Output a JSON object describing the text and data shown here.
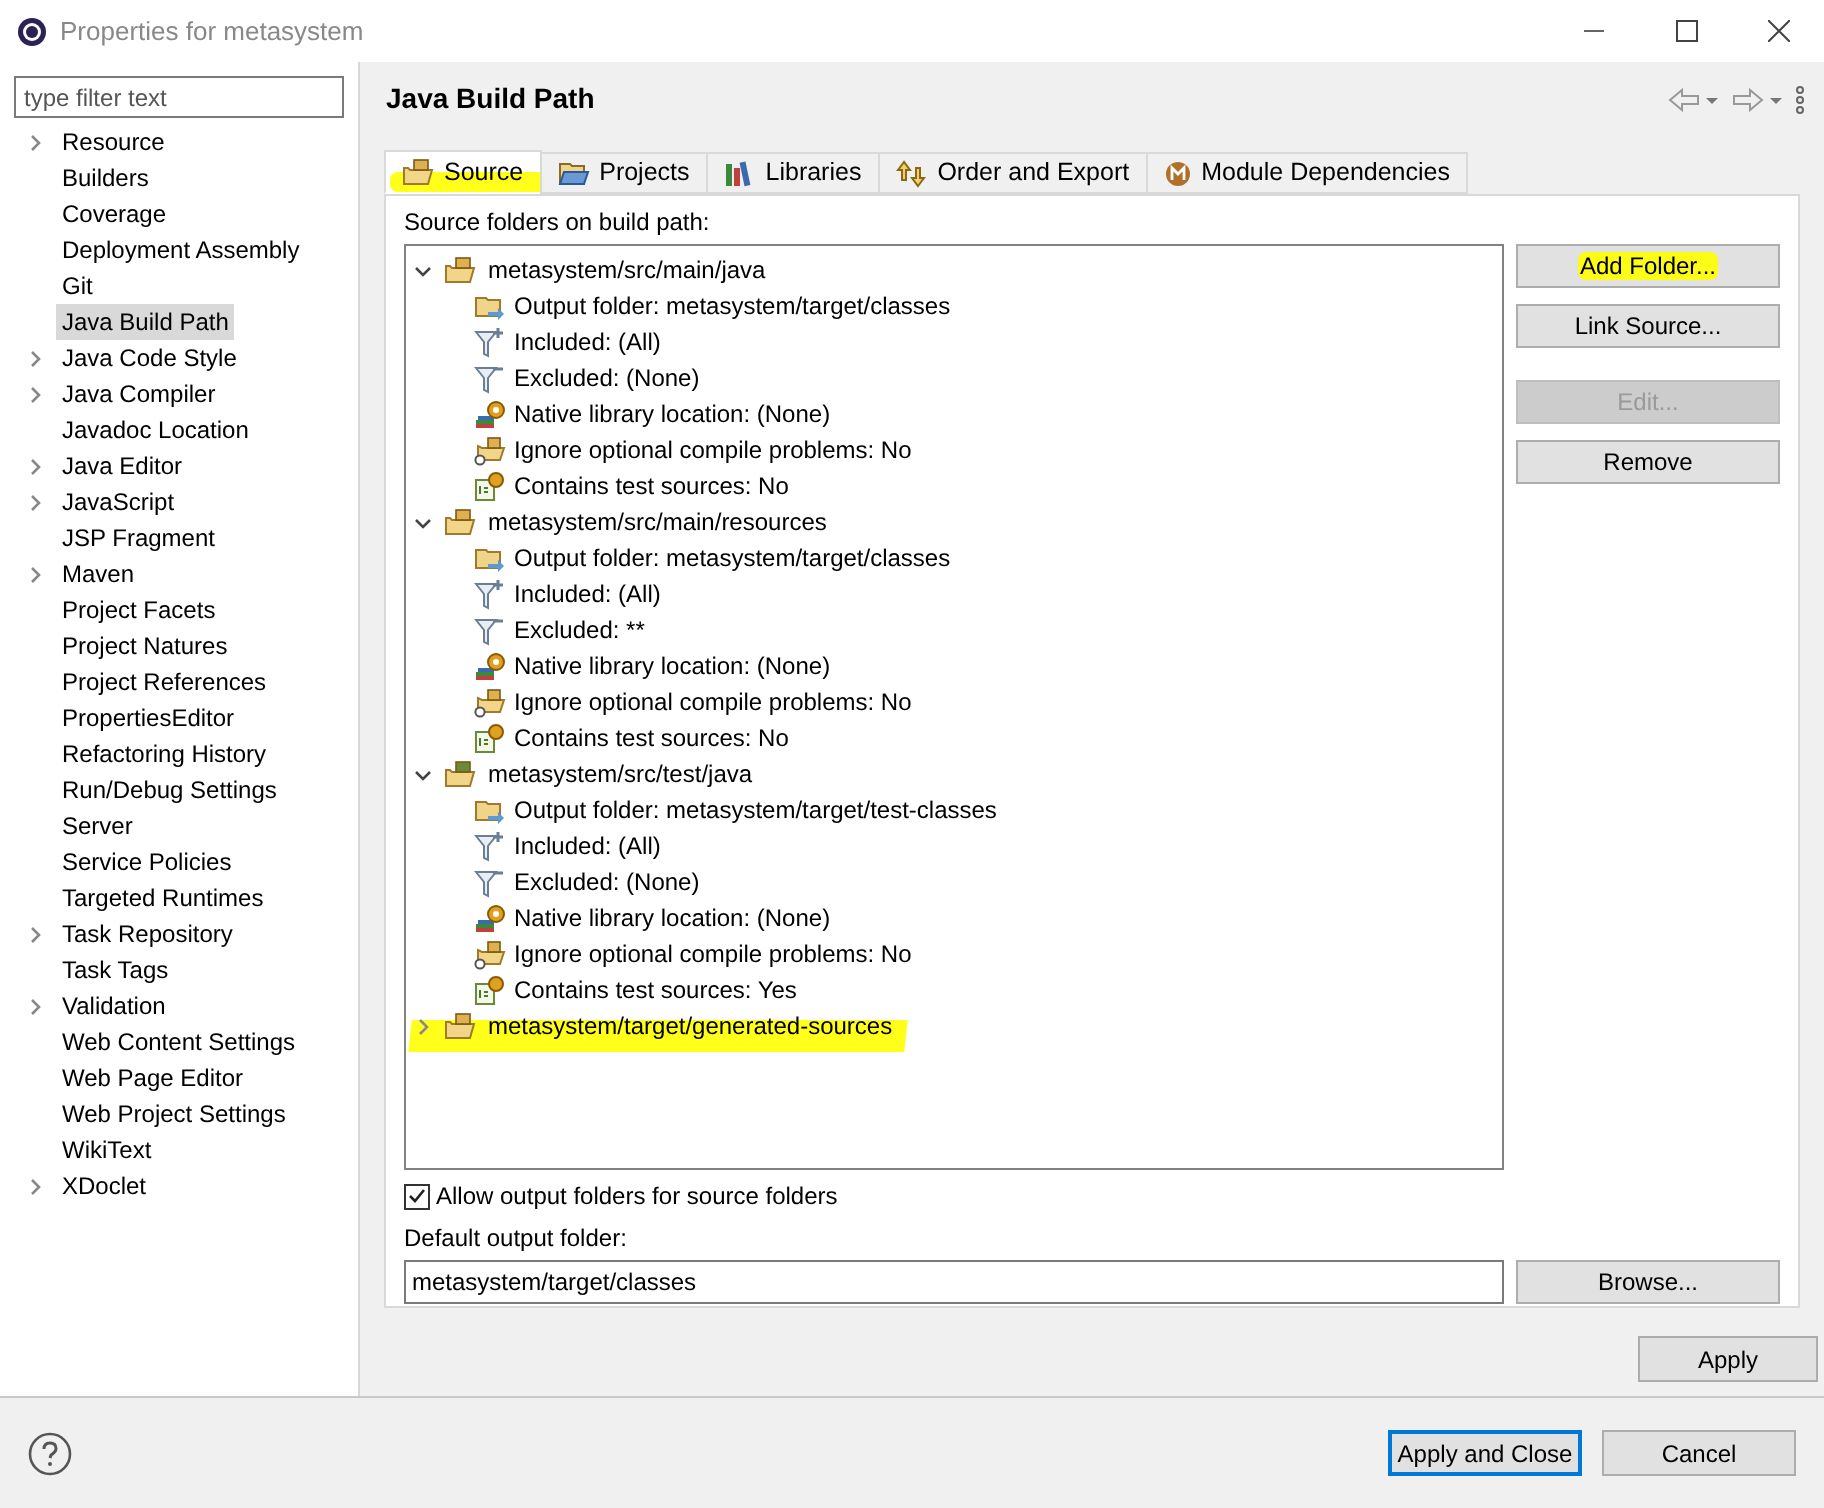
{
  "window": {
    "title": "Properties for metasystem"
  },
  "filter": {
    "placeholder": "type filter text"
  },
  "sidebar": {
    "items": [
      {
        "label": "Resource",
        "expandable": true,
        "selected": false
      },
      {
        "label": "Builders",
        "expandable": false,
        "selected": false
      },
      {
        "label": "Coverage",
        "expandable": false,
        "selected": false
      },
      {
        "label": "Deployment Assembly",
        "expandable": false,
        "selected": false
      },
      {
        "label": "Git",
        "expandable": false,
        "selected": false
      },
      {
        "label": "Java Build Path",
        "expandable": false,
        "selected": true
      },
      {
        "label": "Java Code Style",
        "expandable": true,
        "selected": false
      },
      {
        "label": "Java Compiler",
        "expandable": true,
        "selected": false
      },
      {
        "label": "Javadoc Location",
        "expandable": false,
        "selected": false
      },
      {
        "label": "Java Editor",
        "expandable": true,
        "selected": false
      },
      {
        "label": "JavaScript",
        "expandable": true,
        "selected": false
      },
      {
        "label": "JSP Fragment",
        "expandable": false,
        "selected": false
      },
      {
        "label": "Maven",
        "expandable": true,
        "selected": false
      },
      {
        "label": "Project Facets",
        "expandable": false,
        "selected": false
      },
      {
        "label": "Project Natures",
        "expandable": false,
        "selected": false
      },
      {
        "label": "Project References",
        "expandable": false,
        "selected": false
      },
      {
        "label": "PropertiesEditor",
        "expandable": false,
        "selected": false
      },
      {
        "label": "Refactoring History",
        "expandable": false,
        "selected": false
      },
      {
        "label": "Run/Debug Settings",
        "expandable": false,
        "selected": false
      },
      {
        "label": "Server",
        "expandable": false,
        "selected": false
      },
      {
        "label": "Service Policies",
        "expandable": false,
        "selected": false
      },
      {
        "label": "Targeted Runtimes",
        "expandable": false,
        "selected": false
      },
      {
        "label": "Task Repository",
        "expandable": true,
        "selected": false
      },
      {
        "label": "Task Tags",
        "expandable": false,
        "selected": false
      },
      {
        "label": "Validation",
        "expandable": true,
        "selected": false
      },
      {
        "label": "Web Content Settings",
        "expandable": false,
        "selected": false
      },
      {
        "label": "Web Page Editor",
        "expandable": false,
        "selected": false
      },
      {
        "label": "Web Project Settings",
        "expandable": false,
        "selected": false
      },
      {
        "label": "WikiText",
        "expandable": false,
        "selected": false
      },
      {
        "label": "XDoclet",
        "expandable": true,
        "selected": false
      }
    ]
  },
  "page": {
    "title": "Java Build Path"
  },
  "tabs": [
    {
      "label": "Source",
      "kind": "source",
      "selected": true,
      "highlighted": true
    },
    {
      "label": "Projects",
      "kind": "projects",
      "selected": false,
      "highlighted": false
    },
    {
      "label": "Libraries",
      "kind": "libraries",
      "selected": false,
      "highlighted": false
    },
    {
      "label": "Order and Export",
      "kind": "order",
      "selected": false,
      "highlighted": false
    },
    {
      "label": "Module Dependencies",
      "kind": "module",
      "selected": false,
      "highlighted": false
    }
  ],
  "source_label": "Source folders on build path:",
  "tree": [
    {
      "label": "metasystem/src/main/java",
      "kind": "main",
      "expanded": true,
      "highlighted": false,
      "children": [
        {
          "label": "Output folder: metasystem/target/classes",
          "kind": "output"
        },
        {
          "label": "Included: (All)",
          "kind": "included"
        },
        {
          "label": "Excluded: (None)",
          "kind": "excluded"
        },
        {
          "label": "Native library location: (None)",
          "kind": "native"
        },
        {
          "label": "Ignore optional compile problems: No",
          "kind": "ignore"
        },
        {
          "label": "Contains test sources: No",
          "kind": "test"
        }
      ]
    },
    {
      "label": "metasystem/src/main/resources",
      "kind": "main",
      "expanded": true,
      "highlighted": false,
      "children": [
        {
          "label": "Output folder: metasystem/target/classes",
          "kind": "output"
        },
        {
          "label": "Included: (All)",
          "kind": "included"
        },
        {
          "label": "Excluded: **",
          "kind": "excluded"
        },
        {
          "label": "Native library location: (None)",
          "kind": "native"
        },
        {
          "label": "Ignore optional compile problems: No",
          "kind": "ignore"
        },
        {
          "label": "Contains test sources: No",
          "kind": "test"
        }
      ]
    },
    {
      "label": "metasystem/src/test/java",
      "kind": "testroot",
      "expanded": true,
      "highlighted": false,
      "children": [
        {
          "label": "Output folder: metasystem/target/test-classes",
          "kind": "output"
        },
        {
          "label": "Included: (All)",
          "kind": "included"
        },
        {
          "label": "Excluded: (None)",
          "kind": "excluded"
        },
        {
          "label": "Native library location: (None)",
          "kind": "native"
        },
        {
          "label": "Ignore optional compile problems: No",
          "kind": "ignore"
        },
        {
          "label": "Contains test sources: Yes",
          "kind": "test"
        }
      ]
    },
    {
      "label": "metasystem/target/generated-sources",
      "kind": "main",
      "expanded": false,
      "highlighted": true
    }
  ],
  "side_buttons": [
    {
      "label": "Add Folder...",
      "disabled": false,
      "highlighted": true
    },
    {
      "label": "Link Source...",
      "disabled": false,
      "highlighted": false
    },
    {
      "label": "Edit...",
      "disabled": true,
      "highlighted": false
    },
    {
      "label": "Remove",
      "disabled": false,
      "highlighted": false
    }
  ],
  "allow_output": {
    "label": "Allow output folders for source folders",
    "checked": true
  },
  "default_output": {
    "label": "Default output folder:",
    "value": "metasystem/target/classes",
    "button": "Browse..."
  },
  "apply": "Apply",
  "footer": {
    "apply_close": "Apply and Close",
    "cancel": "Cancel"
  }
}
